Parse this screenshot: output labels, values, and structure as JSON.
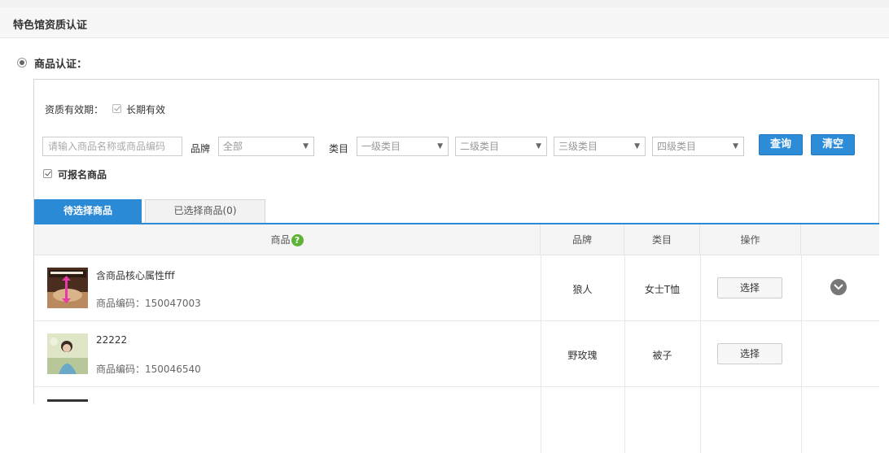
{
  "header": {
    "title": "特色馆资质认证"
  },
  "section": {
    "label": "商品认证："
  },
  "filters": {
    "validity_label": "资质有效期：",
    "long_term_label": "长期有效",
    "search_placeholder": "请输入商品名称或商品编码",
    "brand_label": "品牌",
    "brand_value": "全部",
    "category_label": "类目",
    "cat1": "一级类目",
    "cat2": "二级类目",
    "cat3": "三级类目",
    "cat4": "四级类目",
    "query_button": "查询",
    "clear_button": "清空",
    "available_label": "可报名商品"
  },
  "tabs": {
    "pending": "待选择商品",
    "selected": "已选择商品(0)"
  },
  "table": {
    "headers": {
      "product": "商品",
      "brand": "品牌",
      "category": "类目",
      "action": "操作"
    },
    "code_prefix": "商品编码：",
    "rows": [
      {
        "name": "含商品核心属性fff",
        "code": "150047003",
        "brand": "狼人",
        "category": "女士T恤",
        "action": "选择"
      },
      {
        "name": "22222",
        "code": "150046540",
        "brand": "野玫瑰",
        "category": "被子",
        "action": "选择"
      }
    ]
  },
  "colors": {
    "accent": "#2b8ad6",
    "help": "#5cb335"
  },
  "icons": {
    "radio": "radio-selected-icon",
    "check": "checkbox-checked-icon",
    "help": "question-icon",
    "expand": "chevron-down-circle-icon"
  }
}
